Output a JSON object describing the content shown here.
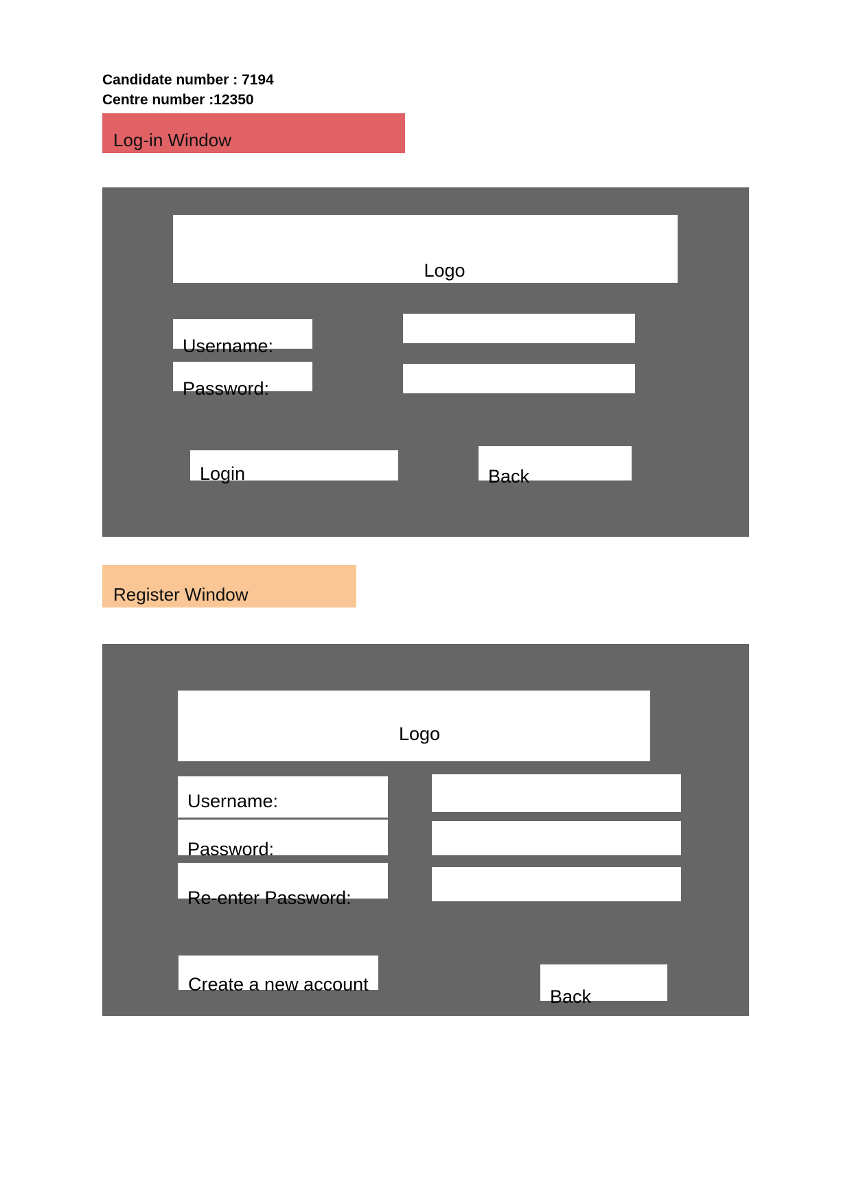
{
  "header": {
    "candidate_line": "Candidate number : 7194",
    "centre_line": "Centre number :12350"
  },
  "colors": {
    "login_bar": "#e06265",
    "register_bar": "#fac695",
    "panel": "#666666",
    "box": "#ffffff",
    "text": "#000000"
  },
  "sections": [
    {
      "id": "login",
      "bar_label": "Log-in Window",
      "bar_color": "#e06265"
    },
    {
      "id": "register",
      "bar_label": "Register Window",
      "bar_color": "#fac695"
    }
  ],
  "login_window": {
    "logo_label": "Logo",
    "username_label": "Username:",
    "password_label": "Password:",
    "username_value": "",
    "password_value": "",
    "submit_label": "Login",
    "back_label": "Back"
  },
  "register_window": {
    "logo_label": "Logo",
    "username_label": "Username:",
    "password_label": "Password:",
    "repassword_label": "Re-enter Password:",
    "username_value": "",
    "password_value": "",
    "repassword_value": "",
    "create_label": "Create a new account",
    "back_label": "Back"
  }
}
